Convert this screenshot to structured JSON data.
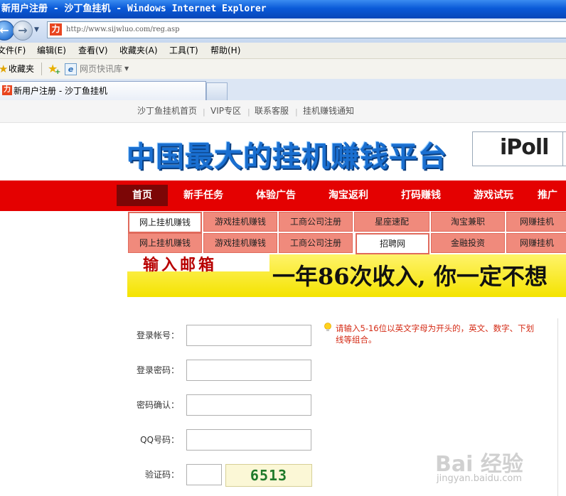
{
  "browser": {
    "title": "新用户注册 - 沙丁鱼挂机 - Windows Internet Explorer",
    "url": "http://www.sijwluo.com/reg.asp",
    "menu": [
      "文件(F)",
      "编辑(E)",
      "查看(V)",
      "收藏夹(A)",
      "工具(T)",
      "帮助(H)"
    ],
    "favorites_label": "收藏夹",
    "web_slice_label": "网页快讯库",
    "tab_label": "新用户注册 - 沙丁鱼挂机"
  },
  "site": {
    "topnav": [
      "沙丁鱼挂机首页",
      "VIP专区",
      "联系客服",
      "挂机赚钱通知"
    ],
    "slogan": "中国最大的挂机赚钱平台",
    "ad_text": "iPoll",
    "mainnav": [
      "首页",
      "新手任务",
      "体验广告",
      "淘宝返利",
      "打码赚钱",
      "游戏试玩",
      "推广"
    ],
    "categories_row1": [
      "网上挂机赚钱",
      "游戏挂机赚钱",
      "工商公司注册",
      "星座速配",
      "淘宝兼职",
      "网赚挂机"
    ],
    "categories_row2": [
      "网上挂机赚钱",
      "游戏挂机赚钱",
      "工商公司注册",
      "招聘网",
      "金融投资",
      "网赚挂机"
    ],
    "banner_left": "输入邮箱",
    "banner_slogan": "一年86次收入, 你一定不想"
  },
  "form": {
    "account_label": "登录帐号：",
    "password_label": "登录密码：",
    "confirm_label": "密码确认：",
    "qq_label": "QQ号码：",
    "captcha_label": "验证码：",
    "captcha_code": "6513",
    "hint": "请输入5-16位以英文字母为开头的，英文、数字、下划线等组合。"
  },
  "watermark": {
    "logo": "Bai 经验",
    "url": "jingyan.baidu.com"
  }
}
